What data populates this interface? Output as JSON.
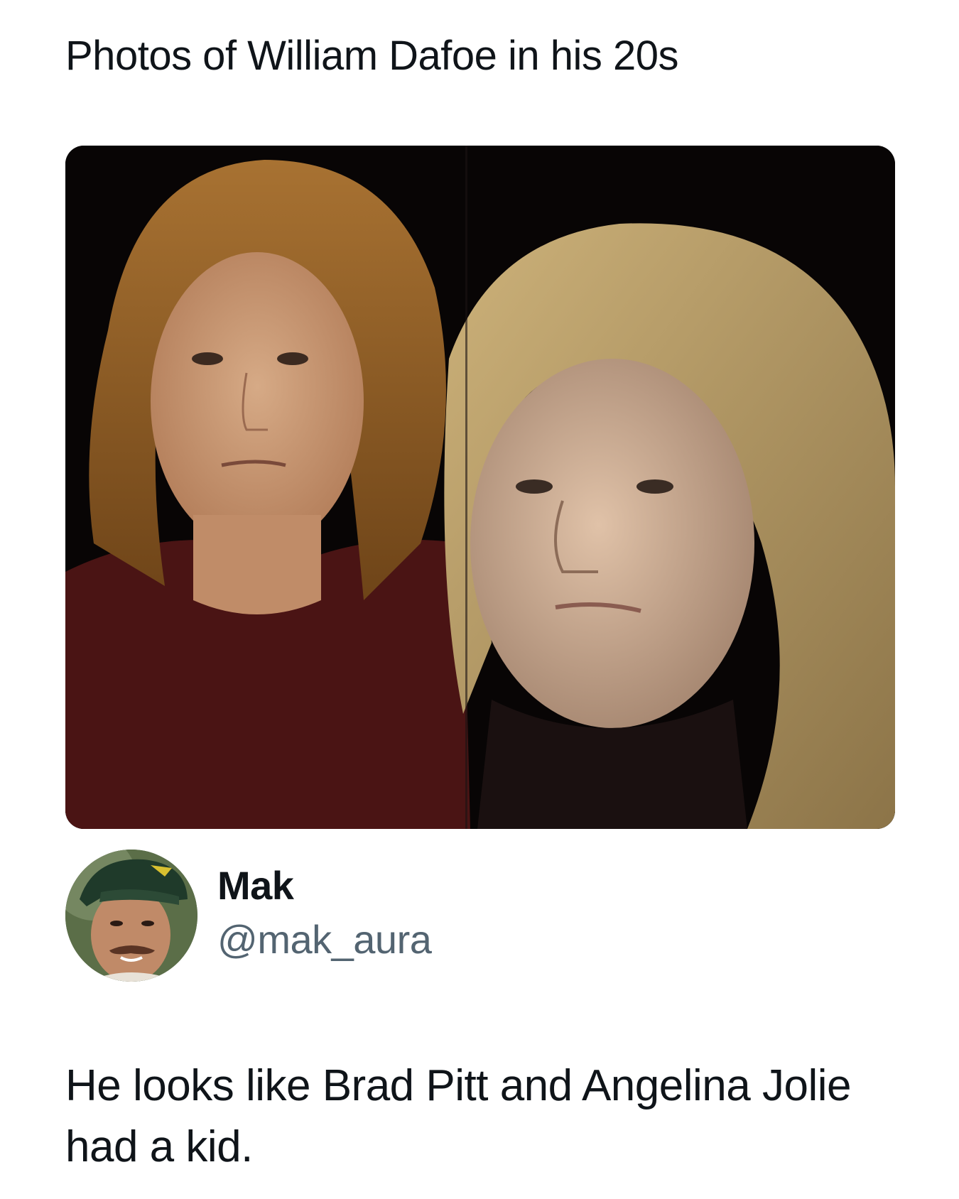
{
  "quoted_post": {
    "text": "Photos of William Dafoe in his 20s",
    "media": {
      "icon": "photo-collage",
      "colors": {
        "background": "#080505",
        "hair_left": "#8a5a24",
        "hair_right": "#b89a62",
        "shirt_left": "#4a1414",
        "skin": "#c89a78"
      }
    }
  },
  "reply": {
    "author": {
      "display_name": "Mak",
      "handle": "@mak_aura",
      "avatar_icon": "profile-photo"
    },
    "text": "He looks like Brad Pitt and Angelina Jolie had a kid."
  },
  "colors": {
    "text_primary": "#0f1419",
    "text_secondary": "#536471",
    "background": "#ffffff"
  }
}
